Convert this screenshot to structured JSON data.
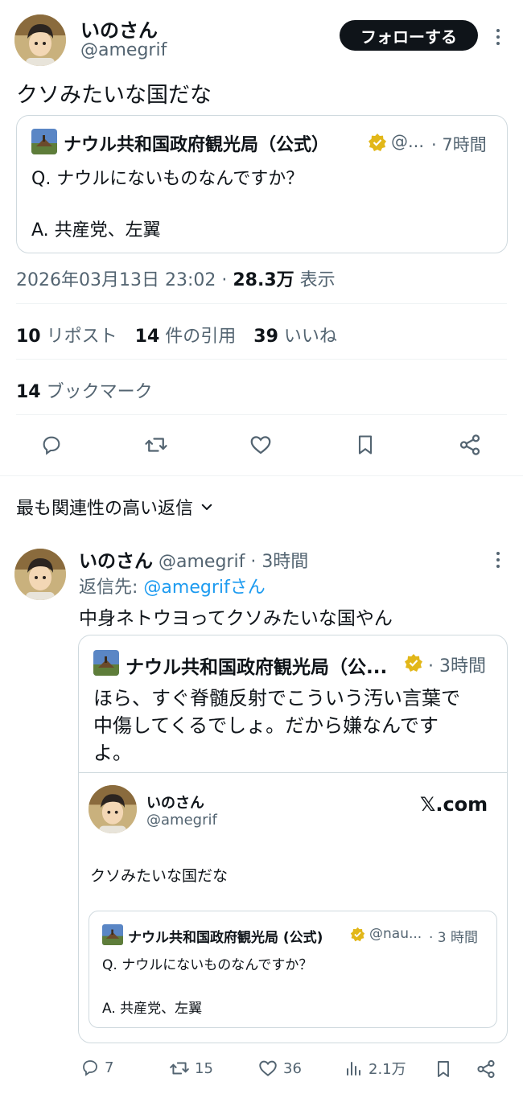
{
  "main_tweet": {
    "author_name": "いのさん",
    "author_handle": "@amegrif",
    "follow_label": "フォローする",
    "text": "クソみたいな国だな",
    "quoted": {
      "name": "ナウル共和国政府観光局（公式）",
      "handle": "@...",
      "time": "· 7時間",
      "line1": "Q. ナウルにないものなんですか？",
      "line2": "A. 共産党、左翼"
    },
    "timestamp": "2026年03月13日 23:02 ·",
    "views_count": "28.3万",
    "views_label": "表示",
    "stats": {
      "reposts_count": "10",
      "reposts_label": "リポスト",
      "quotes_count": "14",
      "quotes_label": "件の引用",
      "likes_count": "39",
      "likes_label": "いいね",
      "bookmarks_count": "14",
      "bookmarks_label": "ブックマーク"
    }
  },
  "replies_sort_label": "最も関連性の高い返信",
  "reply": {
    "author_name": "いのさん",
    "author_handle": "@amegrif",
    "time": "· 3時間",
    "reply_to_prefix": "返信先: ",
    "reply_to_handle": "@amegrifさん",
    "text": "中身ネトウヨってクソみたいな国やん",
    "quoted": {
      "name": "ナウル共和国政府観光局（公...",
      "time": "· 3時間",
      "text_line1": "ほら、すぐ脊髄反射でこういう汚い言葉で",
      "text_line2": "中傷してくるでしょ。だから嫌なんです",
      "text_line3": "よ。",
      "embed": {
        "author_name": "いのさん",
        "author_handle": "@amegrif",
        "brand": "𝕏.com",
        "text": "クソみたいな国だな",
        "inner": {
          "name": "ナウル共和国政府観光局 (公式)",
          "handle": "@nau...",
          "time": "· 3 時間",
          "line1": "Q. ナウルにないものなんですか？",
          "line2": "A. 共産党、左翼"
        }
      }
    },
    "actions": {
      "replies": "7",
      "reposts": "15",
      "likes": "36",
      "views": "2.1万"
    }
  },
  "colors": {
    "accent": "#1d9bf0",
    "muted": "#536471",
    "verified": "#e2b719"
  },
  "icons": [
    "kebab-icon",
    "reply-icon",
    "repost-icon",
    "like-icon",
    "bookmark-icon",
    "share-icon",
    "views-icon",
    "verified-icon",
    "chevron-down-icon"
  ]
}
